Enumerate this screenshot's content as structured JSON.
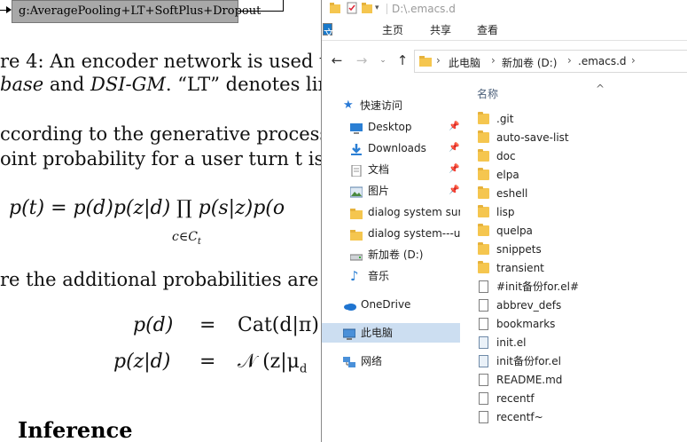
{
  "paper": {
    "box_label": "g:AveragePooling+LT+SoftPlus+Dropout",
    "line1": "re 4:  An encoder network is used to",
    "line2_a": "base",
    "line2_b": " and ",
    "line2_c": "DSI-GM",
    "line2_d": ". “LT” denotes linear",
    "line3": "ccording to the generative process s",
    "line4": "oint probability for a user turn t is",
    "eq1": "p(t) = p(d)p(z|d) ∏ p(s|z)p(o",
    "eq1_sub": "c∈C",
    "eq1_sub_t": "t",
    "line5": "re the additional probabilities are d",
    "eq2_lhs": "p(d)",
    "eq2_eq": "=",
    "eq2_rhs": "Cat(d|π)",
    "eq3_lhs": "p(z|d)",
    "eq3_eq": "=",
    "eq3_rhs": "𝒩 (z|μ",
    "eq3_sub": "d",
    "heading": "Inference"
  },
  "explorer": {
    "title_path": "D:\\.emacs.d",
    "ribbon_tabs": [
      "文件",
      "主页",
      "共享",
      "查看"
    ],
    "breadcrumbs": [
      "此电脑",
      "新加卷 (D:)",
      ".emacs.d"
    ],
    "nav": {
      "quick_access": "快速访问",
      "items": [
        {
          "label": "Desktop",
          "icon": "desktop-icon",
          "pinned": true
        },
        {
          "label": "Downloads",
          "icon": "downloads-icon",
          "pinned": true
        },
        {
          "label": "文档",
          "icon": "documents-icon",
          "pinned": true
        },
        {
          "label": "图片",
          "icon": "pictures-icon",
          "pinned": true
        },
        {
          "label": "dialog system sur",
          "icon": "folder-icon",
          "pinned": false
        },
        {
          "label": "dialog system---u",
          "icon": "folder-icon",
          "pinned": false
        },
        {
          "label": "新加卷 (D:)",
          "icon": "drive-icon",
          "pinned": false
        },
        {
          "label": "音乐",
          "icon": "music-icon",
          "pinned": false
        }
      ],
      "onedrive": "OneDrive",
      "this_pc": "此电脑",
      "network": "网络"
    },
    "column_name": "名称",
    "files": [
      {
        "name": ".git",
        "type": "folder"
      },
      {
        "name": "auto-save-list",
        "type": "folder"
      },
      {
        "name": "doc",
        "type": "folder"
      },
      {
        "name": "elpa",
        "type": "folder"
      },
      {
        "name": "eshell",
        "type": "folder"
      },
      {
        "name": "lisp",
        "type": "folder"
      },
      {
        "name": "quelpa",
        "type": "folder"
      },
      {
        "name": "snippets",
        "type": "folder"
      },
      {
        "name": "transient",
        "type": "folder"
      },
      {
        "name": "#init备份for.el#",
        "type": "file"
      },
      {
        "name": "abbrev_defs",
        "type": "file"
      },
      {
        "name": "bookmarks",
        "type": "file"
      },
      {
        "name": "init.el",
        "type": "el"
      },
      {
        "name": "init备份for.el",
        "type": "el"
      },
      {
        "name": "README.md",
        "type": "md"
      },
      {
        "name": "recentf",
        "type": "file"
      },
      {
        "name": "recentf~",
        "type": "file"
      }
    ]
  }
}
